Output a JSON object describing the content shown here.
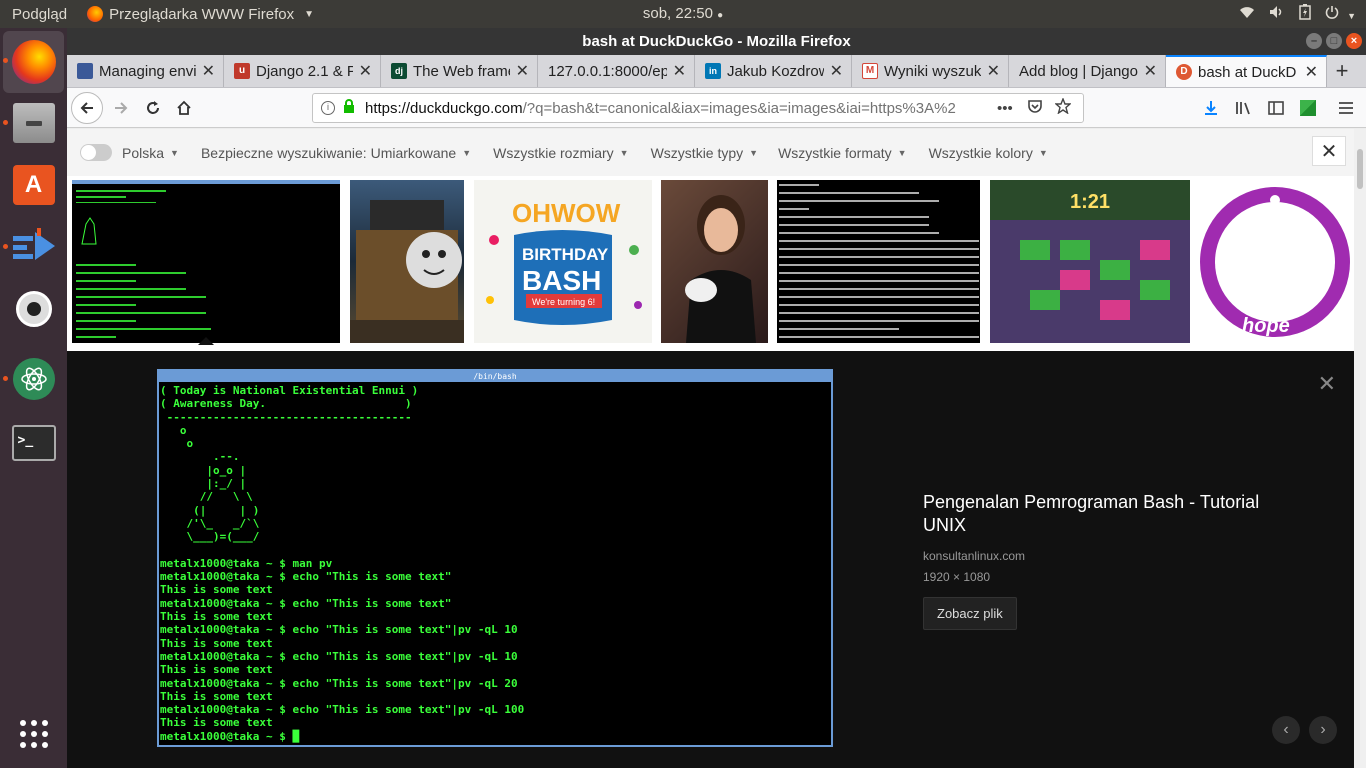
{
  "topbar": {
    "activity": "Podgląd",
    "app_menu": "Przeglądarka WWW Firefox",
    "clock": "sob, 22:50"
  },
  "window": {
    "title": "bash at DuckDuckGo - Mozilla Firefox"
  },
  "tabs": [
    {
      "label": "Managing envi",
      "favicon_color": "#3b5998",
      "favicon_char": ""
    },
    {
      "label": "Django 2.1 & P",
      "favicon_color": "#c0392b",
      "favicon_char": "u"
    },
    {
      "label": "The Web frame",
      "favicon_color": "#0c4b33",
      "favicon_char": "dj"
    },
    {
      "label": "127.0.0.1:8000/ep",
      "favicon_color": "",
      "favicon_char": ""
    },
    {
      "label": "Jakub Kozdrow",
      "favicon_color": "#0077b5",
      "favicon_char": "in"
    },
    {
      "label": "Wyniki wyszuk",
      "favicon_color": "#d44638",
      "favicon_char": "M"
    },
    {
      "label": "Add blog | Django",
      "favicon_color": "",
      "favicon_char": ""
    },
    {
      "label": "bash at DuckD",
      "favicon_color": "#de5833",
      "favicon_char": "D"
    }
  ],
  "urlbar": {
    "host": "https://duckduckgo.com",
    "rest": "/?q=bash&t=canonical&iax=images&ia=images&iai=https%3A%2",
    "more": "•••"
  },
  "filters": {
    "region": "Polska",
    "safe_search": "Bezpieczne wyszukiwanie: Umiarkowane",
    "sizes": "Wszystkie rozmiary",
    "types": "Wszystkie typy",
    "formats": "Wszystkie formaty",
    "colors": "Wszystkie kolory"
  },
  "thumbnails": [
    {
      "name": "terminal-thumb"
    },
    {
      "name": "train-thumb"
    },
    {
      "name": "birthday-bash-thumb",
      "text1": "OHWOW",
      "text2": "BIRTHDAY",
      "text3": "BASH",
      "text4": "We're turning 6!"
    },
    {
      "name": "woman-thumb"
    },
    {
      "name": "portage-terminal-thumb"
    },
    {
      "name": "crash-game-thumb",
      "text1": "1:21"
    },
    {
      "name": "hope-rotor-thumb",
      "text1": "hope"
    }
  ],
  "terminal": {
    "title": "/bin/bash",
    "lines": [
      "( Today is National Existential Ennui )",
      "( Awareness Day.                     )",
      " -------------------------------------",
      "   o",
      "    o",
      "        .--.",
      "       |o_o |",
      "       |:_/ |",
      "      //   \\ \\",
      "     (|     | )",
      "    /'\\_   _/`\\",
      "    \\___)=(___/",
      "",
      "metalx1000@taka ~ $ man pv",
      "metalx1000@taka ~ $ echo \"This is some text\"",
      "This is some text",
      "metalx1000@taka ~ $ echo \"This is some text\"",
      "This is some text",
      "metalx1000@taka ~ $ echo \"This is some text\"|pv -qL 10",
      "This is some text",
      "metalx1000@taka ~ $ echo \"This is some text\"|pv -qL 10",
      "This is some text",
      "metalx1000@taka ~ $ echo \"This is some text\"|pv -qL 20",
      "This is some text",
      "metalx1000@taka ~ $ echo \"This is some text\"|pv -qL 100",
      "This is some text",
      "metalx1000@taka ~ $ █"
    ]
  },
  "detail": {
    "title": "Pengenalan Pemrograman Bash - Tutorial UNIX",
    "domain": "konsultanlinux.com",
    "size": "1920 × 1080",
    "button": "Zobacz plik"
  }
}
